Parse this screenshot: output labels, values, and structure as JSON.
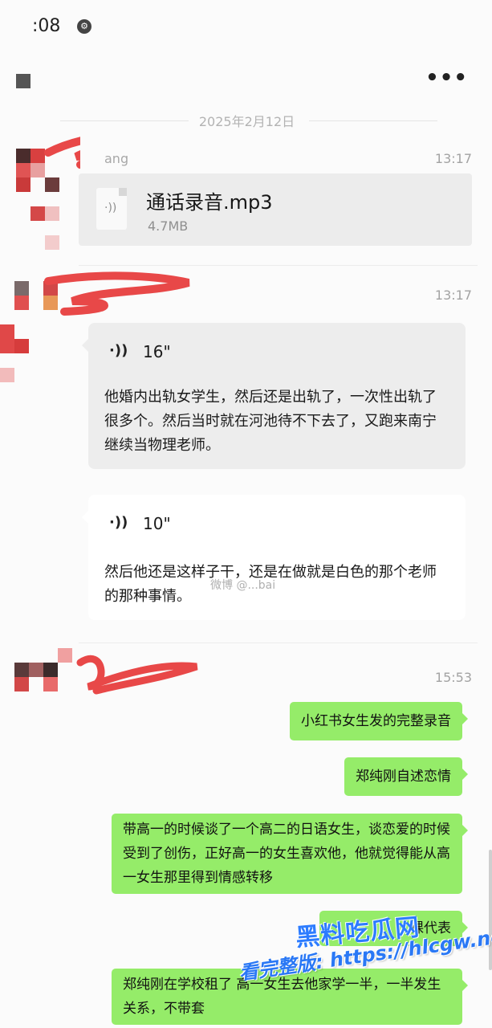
{
  "status_bar": {
    "time": ":08",
    "icon": "settings-icon"
  },
  "header": {
    "more_label": "•••"
  },
  "date_divider": "2025年2月12日",
  "messages": [
    {
      "time": "13:17",
      "file": {
        "name": "通话录音.mp3",
        "size": "4.7MB"
      }
    },
    {
      "time": "13:17",
      "voice_1": {
        "duration": "16\"",
        "text": "他婚内出轨女学生，然后还是出轨了，一次性出轨了很多个。然后当时就在河池待不下去了，又跑来南宁继续当物理老师。"
      },
      "voice_2": {
        "duration": "10\"",
        "text": "然后他还是这样子干，还是在做就是白色的那个老师的那种事情。"
      }
    },
    {
      "time": "15:53",
      "bubbles": [
        "小红书女生发的完整录音",
        "郑纯刚自述恋情",
        "带高一的时候谈了一个高二的日语女生，谈恋爱的时候受到了创伤，正好高一的女生喜欢他，他就觉得能从高一女生那里得到情感转移",
        "课代表",
        "郑纯刚在学校租了 高一女生去他家学一半，一半发生关系，不带套"
      ]
    }
  ],
  "watermarks": {
    "logo": "黑料吃瓜网",
    "site": "看完整版: https://hlcgw.net"
  }
}
